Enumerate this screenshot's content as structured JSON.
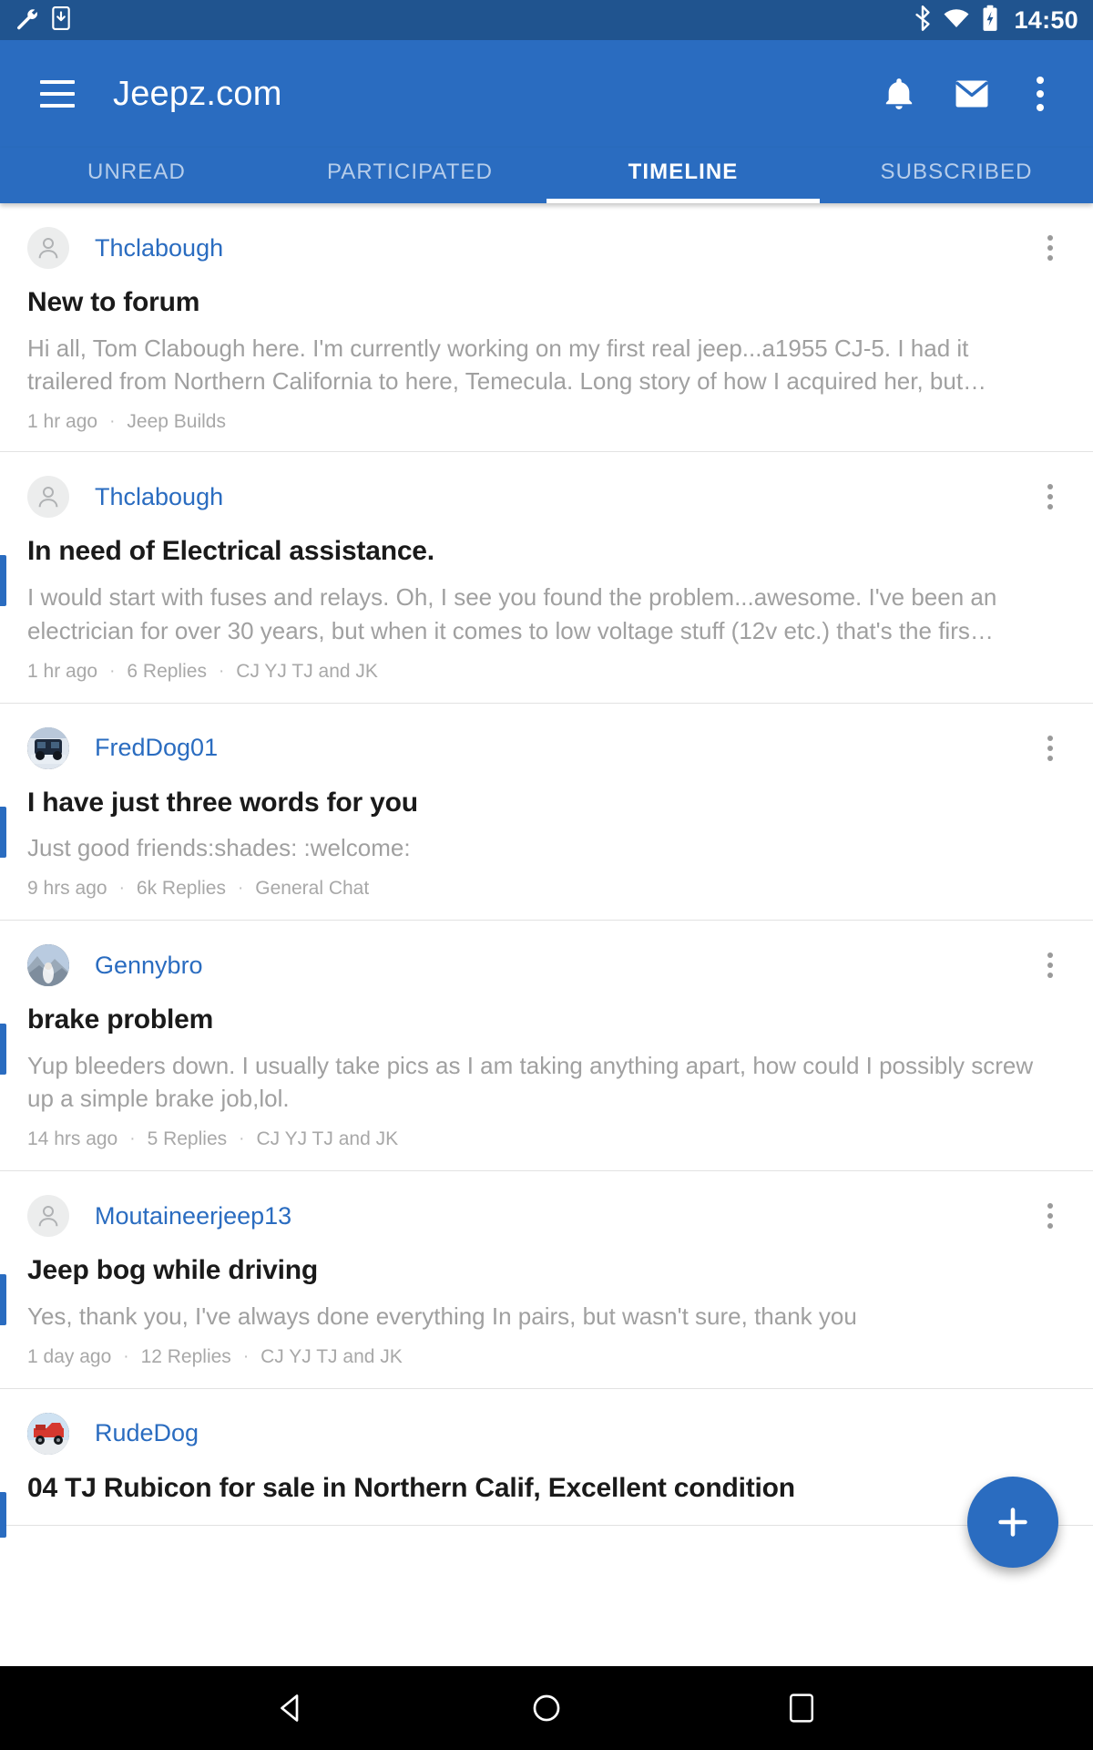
{
  "status_bar": {
    "time": "14:50",
    "left_icons": [
      "wrench-icon",
      "download-to-device-icon"
    ],
    "right_icons": [
      "bluetooth-icon",
      "wifi-icon",
      "battery-charging-icon"
    ]
  },
  "toolbar": {
    "menu_icon": "hamburger-menu-icon",
    "title": "Jeepz.com",
    "notifications_icon": "bell-icon",
    "messages_icon": "envelope-icon",
    "overflow_icon": "kebab-menu-icon"
  },
  "tabs": [
    {
      "label": "UNREAD",
      "active": false
    },
    {
      "label": "PARTICIPATED",
      "active": false
    },
    {
      "label": "TIMELINE",
      "active": true
    },
    {
      "label": "SUBSCRIBED",
      "active": false
    }
  ],
  "posts": [
    {
      "username": "Thclabough",
      "avatar": "default-person-avatar",
      "unread": false,
      "title": "New to forum",
      "body": "Hi all, Tom Clabough here. I'm currently working on my first real jeep...a1955 CJ-5. I had it trailered from Northern California to here, Temecula. Long story of how I acquired her, but…",
      "time": "1 hr ago",
      "replies": "",
      "forum": "Jeep Builds"
    },
    {
      "username": "Thclabough",
      "avatar": "default-person-avatar",
      "unread": true,
      "title": "In need of Electrical assistance.",
      "body": "I would start with fuses and relays. Oh, I see you found the problem...awesome. I've been an electrician for over 30 years, but when it comes to low voltage stuff (12v etc.) that's the firs…",
      "time": "1 hr ago",
      "replies": "6 Replies",
      "forum": "CJ YJ TJ and JK"
    },
    {
      "username": "FredDog01",
      "avatar": "photo-avatar-dark-jeep",
      "unread": true,
      "title": "I have just three words for you",
      "body": "Just good friends:shades: :welcome:",
      "time": "9 hrs ago",
      "replies": "6k Replies",
      "forum": "General Chat"
    },
    {
      "username": "Gennybro",
      "avatar": "photo-avatar-outdoor",
      "unread": true,
      "title": "brake problem",
      "body": "Yup bleeders down. I usually take pics as I am taking anything apart, how could I possibly screw up a simple brake job,lol.",
      "time": "14 hrs ago",
      "replies": "5 Replies",
      "forum": "CJ YJ TJ and JK"
    },
    {
      "username": "Moutaineerjeep13",
      "avatar": "default-person-avatar",
      "unread": true,
      "title": "Jeep bog while driving",
      "body": "Yes, thank you, I've always done everything In pairs, but wasn't sure, thank you",
      "time": "1 day ago",
      "replies": "12 Replies",
      "forum": "CJ YJ TJ and JK"
    },
    {
      "username": "RudeDog",
      "avatar": "photo-avatar-red-jeep",
      "unread": true,
      "title": "04 TJ Rubicon for sale in Northern Calif, Excellent condition",
      "body": "",
      "time": "",
      "replies": "",
      "forum": ""
    }
  ],
  "fab": {
    "icon": "plus-icon",
    "label": "+"
  },
  "nav_bar": {
    "back_icon": "triangle-back-icon",
    "home_icon": "circle-home-icon",
    "recents_icon": "square-recents-icon"
  },
  "colors": {
    "status_bar": "#20548f",
    "toolbar": "#2a6cc0",
    "accent": "#2a6cc0",
    "username_link": "#2a6cc0",
    "title_text": "#1a1a1a",
    "body_text": "#a0a0a0",
    "meta_text": "#a8a8a8",
    "tab_inactive": "#b6cdea",
    "divider": "#e2e2e2",
    "nav_bar": "#000000"
  },
  "meta_separator": "·"
}
